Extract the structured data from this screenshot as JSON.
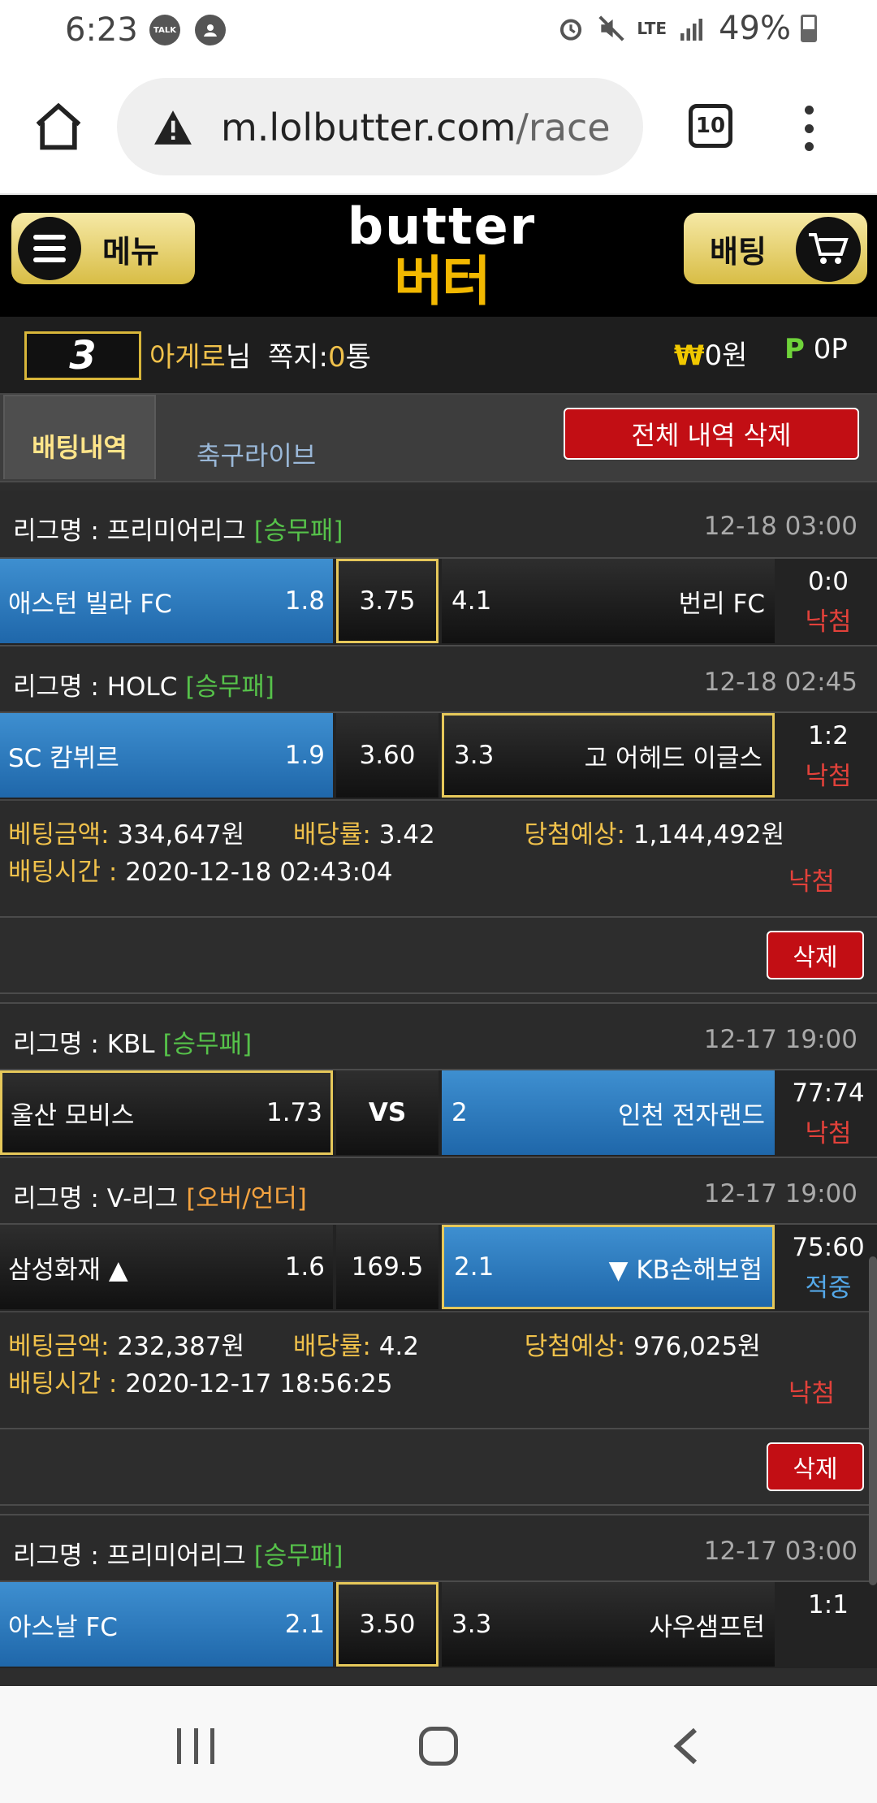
{
  "status": {
    "time": "6:23",
    "notif_talk": "TALK",
    "network": "LTE",
    "battery": "49%"
  },
  "browser": {
    "url_host": "m.lolbutter.com",
    "url_path": "/race",
    "tab_count": "10"
  },
  "header": {
    "menu_label": "메뉴",
    "logo_en": "butter",
    "logo_ko": "버터",
    "bet_label": "배팅"
  },
  "user": {
    "level": "3",
    "name": "아게로",
    "suffix": "님",
    "msg_label": "쪽지:",
    "msg_count": "0",
    "msg_unit": "통",
    "won_symbol": "₩",
    "won": "0원",
    "point_symbol": "P",
    "points": "0P"
  },
  "tabs": {
    "active": "배팅내역",
    "other": "축구라이브",
    "delete_all": "전체 내역 삭제"
  },
  "bets": [
    {
      "league_prefix": "리그명 : 프리미어리그 ",
      "league_tag": "[승무패]",
      "time": "12-18 03:00",
      "home": "애스턴 빌라 FC",
      "home_odds": "1.8",
      "mid": "3.75",
      "away_odds": "4.1",
      "away": "번리 FC",
      "score": "0:0",
      "result": "낙첨"
    },
    {
      "league_prefix": "리그명 : HOLC ",
      "league_tag": "[승무패]",
      "time": "12-18 02:45",
      "home": "SC 캄뷔르",
      "home_odds": "1.9",
      "mid": "3.60",
      "away_odds": "3.3",
      "away": "고 어헤드 이글스",
      "score": "1:2",
      "result": "낙첨"
    },
    {
      "league_prefix": "리그명 : KBL ",
      "league_tag": "[승무패]",
      "time": "12-17 19:00",
      "home": "울산 모비스",
      "home_odds": "1.73",
      "mid": "VS",
      "away_odds": "2",
      "away": "인천 전자랜드",
      "score": "77:74",
      "result": "낙첨"
    },
    {
      "league_prefix": "리그명 : V-리그 ",
      "league_tag": "[오버/언더]",
      "time": "12-17 19:00",
      "home": "삼성화재 ▲",
      "home_odds": "1.6",
      "mid": "169.5",
      "away_odds": "2.1",
      "away": "▼ KB손해보험",
      "score": "75:60",
      "result": "적중"
    },
    {
      "league_prefix": "리그명 : 프리미어리그 ",
      "league_tag": "[승무패]",
      "time": "12-17 03:00",
      "home": "아스날 FC",
      "home_odds": "2.1",
      "mid": "3.50",
      "away_odds": "3.3",
      "away": "사우샘프턴",
      "score": "1:1",
      "result": ""
    }
  ],
  "slips": [
    {
      "amount_label": "베팅금액:",
      "amount": " 334,647원",
      "rate_label": "배당률:",
      "rate": " 3.42",
      "expect_label": "당첨예상:",
      "expect": " 1,144,492원",
      "time_label": "배팅시간 :",
      "time": " 2020-12-18 02:43:04",
      "status": "낙첨",
      "delete": "삭제"
    },
    {
      "amount_label": "베팅금액:",
      "amount": " 232,387원",
      "rate_label": "배당률:",
      "rate": " 4.2",
      "expect_label": "당첨예상:",
      "expect": " 976,025원",
      "time_label": "배팅시간 :",
      "time": " 2020-12-17 18:56:25",
      "status": "낙첨",
      "delete": "삭제"
    }
  ],
  "colors": {
    "accent_gold": "#d8b63a",
    "delete_red": "#c20e14",
    "selected_blue": "#2e7bc0",
    "lose_red": "#e2413a",
    "win_cyan": "#54a8e8"
  }
}
